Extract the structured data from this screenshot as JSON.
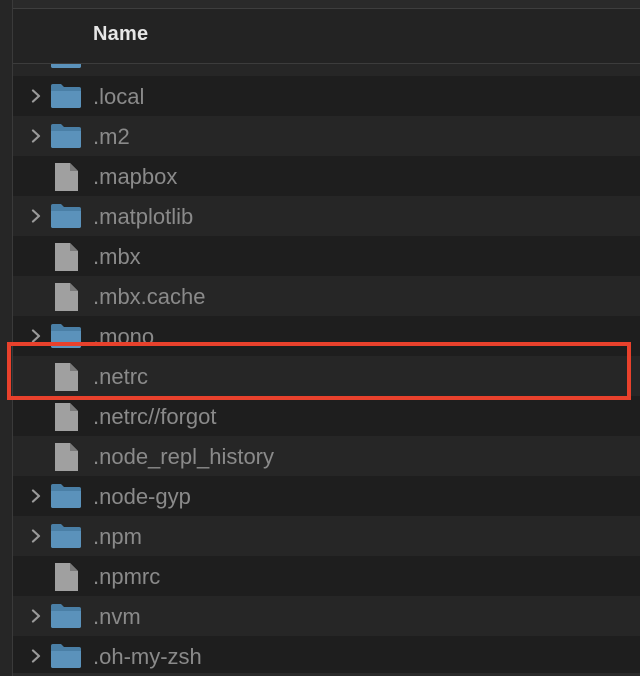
{
  "header": {
    "name_label": "Name"
  },
  "rows": [
    {
      "name": "",
      "kind": "folder",
      "expandable": true
    },
    {
      "name": ".local",
      "kind": "folder",
      "expandable": true
    },
    {
      "name": ".m2",
      "kind": "folder",
      "expandable": true
    },
    {
      "name": ".mapbox",
      "kind": "file",
      "expandable": false
    },
    {
      "name": ".matplotlib",
      "kind": "folder",
      "expandable": true
    },
    {
      "name": ".mbx",
      "kind": "file",
      "expandable": false
    },
    {
      "name": ".mbx.cache",
      "kind": "file",
      "expandable": false
    },
    {
      "name": ".mono",
      "kind": "folder",
      "expandable": true
    },
    {
      "name": ".netrc",
      "kind": "file",
      "expandable": false,
      "highlighted": true
    },
    {
      "name": ".netrc//forgot",
      "kind": "file",
      "expandable": false
    },
    {
      "name": ".node_repl_history",
      "kind": "file",
      "expandable": false
    },
    {
      "name": ".node-gyp",
      "kind": "folder",
      "expandable": true
    },
    {
      "name": ".npm",
      "kind": "folder",
      "expandable": true
    },
    {
      "name": ".npmrc",
      "kind": "file",
      "expandable": false
    },
    {
      "name": ".nvm",
      "kind": "folder",
      "expandable": true
    },
    {
      "name": ".oh-my-zsh",
      "kind": "folder",
      "expandable": true
    }
  ],
  "colors": {
    "background": "#1e1e1e",
    "stripe": "#262626",
    "text": "#8a8a8a",
    "folder": "#4a7fa6",
    "file": "#a0a0a0",
    "highlight": "#e8412c"
  },
  "icons": {
    "folder": "folder-icon",
    "file": "document-icon",
    "chevron": "chevron-right-icon"
  }
}
